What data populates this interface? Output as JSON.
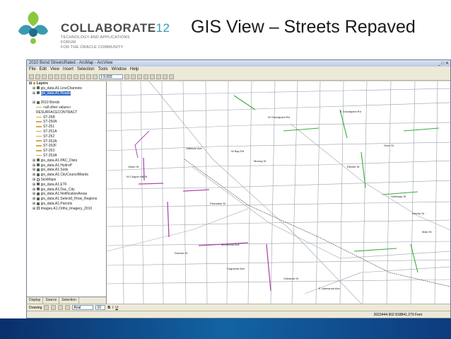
{
  "slide": {
    "title": "GIS View – Streets Repaved",
    "logo_name": "COLLABORATE",
    "logo_num": "12",
    "logo_tagline": [
      "TECHNOLOGY AND APPLICATIONS FORUM",
      "FOR THE ORACLE COMMUNITY"
    ]
  },
  "app": {
    "window_title": "2010 Bond StreetsRated - ArcMap - ArcView",
    "menu": [
      "File",
      "Edit",
      "View",
      "Insert",
      "Selection",
      "Tools",
      "Window",
      "Help"
    ],
    "scale": "1:9,693"
  },
  "toc": {
    "layers_root": "Layers",
    "items": [
      {
        "label": "gis_data.A1.LineChannels",
        "checked": true,
        "selected": false,
        "indent": 1
      },
      {
        "label": "gis_data.A1.Roads",
        "checked": true,
        "selected": true,
        "indent": 1
      },
      {
        "label": "",
        "checked": false,
        "selected": false,
        "indent": 1,
        "spacer": true
      },
      {
        "label": "2010 Bonds",
        "checked": true,
        "selected": false,
        "indent": 1
      },
      {
        "label": "<all other values>",
        "checked": false,
        "selected": false,
        "indent": 2,
        "sym": true
      },
      {
        "label": "RESURFACECONTRACT",
        "checked": false,
        "selected": false,
        "indent": 2
      },
      {
        "label": "ST-25B",
        "checked": false,
        "selected": false,
        "indent": 2,
        "sym": true
      },
      {
        "label": "ST-250A",
        "checked": false,
        "selected": false,
        "indent": 2,
        "sym": true
      },
      {
        "label": "ST-251",
        "checked": false,
        "selected": false,
        "indent": 2,
        "sym": true
      },
      {
        "label": "ST-251A",
        "checked": false,
        "selected": false,
        "indent": 2,
        "sym": true
      },
      {
        "label": "ST-252",
        "checked": false,
        "selected": false,
        "indent": 2,
        "sym": true
      },
      {
        "label": "ST-252A",
        "checked": false,
        "selected": false,
        "indent": 2,
        "sym": true
      },
      {
        "label": "ST-252F",
        "checked": false,
        "selected": false,
        "indent": 2,
        "sym": true
      },
      {
        "label": "ST-253",
        "checked": false,
        "selected": false,
        "indent": 2,
        "sym": true
      },
      {
        "label": "ST-253A",
        "checked": false,
        "selected": false,
        "indent": 2,
        "sym": true
      },
      {
        "label": "gis_data.A1.PAC_Dists",
        "checked": true,
        "selected": false,
        "indent": 1
      },
      {
        "label": "gis_data.A1.HydroP",
        "checked": true,
        "selected": false,
        "indent": 1
      },
      {
        "label": "gis_data.A1.Soils",
        "checked": true,
        "selected": false,
        "indent": 1
      },
      {
        "label": "gis_data.A1.CityCouncilWards",
        "checked": true,
        "selected": false,
        "indent": 1
      },
      {
        "label": "SickMaps",
        "checked": false,
        "selected": false,
        "indent": 1
      },
      {
        "label": "gis_data.A1.ETF",
        "checked": true,
        "selected": false,
        "indent": 1
      },
      {
        "label": "gis_data.A1.Dac_City",
        "checked": true,
        "selected": false,
        "indent": 1
      },
      {
        "label": "gis_data.A1.NotificationAreas",
        "checked": true,
        "selected": false,
        "indent": 1
      },
      {
        "label": "gis_data.A1.Selectd_Hrsw_Regions",
        "checked": true,
        "selected": false,
        "indent": 1
      },
      {
        "label": "gis_data.A1.Parcels",
        "checked": true,
        "selected": false,
        "indent": 1
      },
      {
        "label": "Images.A1.Ortho_Imagery_2010",
        "checked": false,
        "selected": false,
        "indent": 1
      }
    ],
    "tabs": [
      "Display",
      "Source",
      "Selection"
    ]
  },
  "map": {
    "street_labels": [
      {
        "text": "W Grandpoint Rd",
        "pos": "top-center"
      },
      {
        "text": "E Grandpoint Rd",
        "pos": "top-right"
      },
      {
        "text": "Vallance Ave",
        "pos": "mid-left"
      },
      {
        "text": "W Bay Rd",
        "pos": "mid-center"
      },
      {
        "text": "Murray St",
        "pos": "mid-center"
      },
      {
        "text": "Olsen St",
        "pos": "left"
      },
      {
        "text": "W Chapel Hill St",
        "pos": "left"
      },
      {
        "text": "Parmalee St",
        "pos": "center"
      },
      {
        "text": "Morehead Ave",
        "pos": "center"
      },
      {
        "text": "Dunbar St",
        "pos": "lower-left"
      },
      {
        "text": "Huguenot Ave",
        "pos": "lower-center"
      },
      {
        "text": "Geer St",
        "pos": "right"
      },
      {
        "text": "Ellerbe St",
        "pos": "right"
      },
      {
        "text": "Holloway St",
        "pos": "right"
      },
      {
        "text": "Liberty St",
        "pos": "right"
      },
      {
        "text": "Main St",
        "pos": "right"
      },
      {
        "text": "E Lakewood Ave",
        "pos": "bottom"
      },
      {
        "text": "Chestnut St",
        "pos": "bottom"
      }
    ]
  },
  "drawbar": {
    "drawing_label": "Drawing",
    "font": "Arial",
    "size": "10"
  },
  "status": {
    "coords": "2023444.902  818841.279 Feet"
  },
  "colors": {
    "resurfaced_purple": "#b046b0",
    "resurfaced_green": "#3bab3b",
    "street_gray": "#9aa2aa",
    "footer_blue": "#1363a3",
    "accent_teal": "#3a9ab0"
  }
}
